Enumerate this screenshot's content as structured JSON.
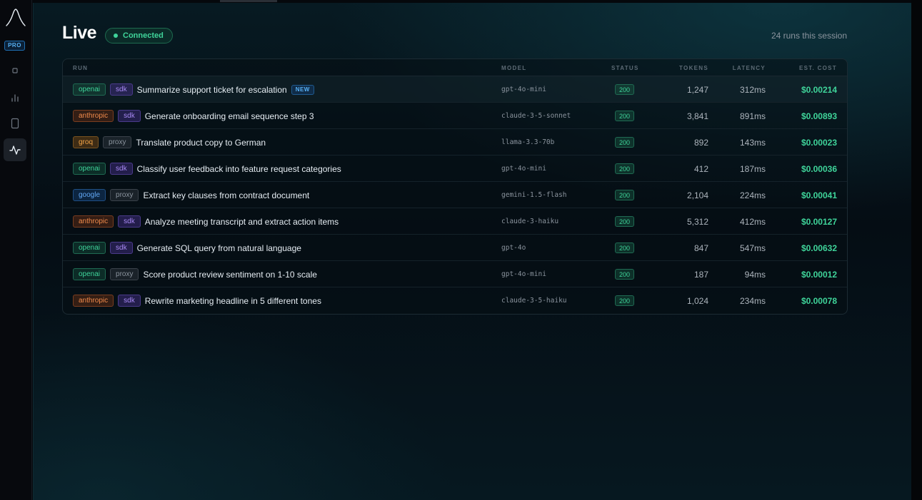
{
  "sidebar": {
    "badge": "PRO",
    "logo_icon": "sparkline-logo-icon",
    "items": [
      {
        "name": "overview",
        "icon": "square-icon",
        "active": false
      },
      {
        "name": "analytics",
        "icon": "bar-chart-icon",
        "active": false
      },
      {
        "name": "devices",
        "icon": "device-icon",
        "active": false
      },
      {
        "name": "live",
        "icon": "activity-icon",
        "active": true
      }
    ]
  },
  "header": {
    "title": "Live",
    "connection_status": "Connected",
    "session_count": "24 runs this session"
  },
  "table": {
    "columns": {
      "run": "RUN",
      "model": "MODEL",
      "status": "STATUS",
      "tokens": "TOKENS",
      "latency": "LATENCY",
      "cost": "EST. COST"
    },
    "rows": [
      {
        "provider": "openai",
        "source": "sdk",
        "title": "Summarize support ticket for escalation",
        "badge": "NEW",
        "model": "gpt-4o-mini",
        "status": "200",
        "tokens": "1,247",
        "latency": "312ms",
        "cost": "$0.00214"
      },
      {
        "provider": "anthropic",
        "source": "sdk",
        "title": "Generate onboarding email sequence step 3",
        "badge": "",
        "model": "claude-3-5-sonnet",
        "status": "200",
        "tokens": "3,841",
        "latency": "891ms",
        "cost": "$0.00893"
      },
      {
        "provider": "groq",
        "source": "proxy",
        "title": "Translate product copy to German",
        "badge": "",
        "model": "llama-3.3-70b",
        "status": "200",
        "tokens": "892",
        "latency": "143ms",
        "cost": "$0.00023"
      },
      {
        "provider": "openai",
        "source": "sdk",
        "title": "Classify user feedback into feature request categories",
        "badge": "",
        "model": "gpt-4o-mini",
        "status": "200",
        "tokens": "412",
        "latency": "187ms",
        "cost": "$0.00036"
      },
      {
        "provider": "google",
        "source": "proxy",
        "title": "Extract key clauses from contract document",
        "badge": "",
        "model": "gemini-1.5-flash",
        "status": "200",
        "tokens": "2,104",
        "latency": "224ms",
        "cost": "$0.00041"
      },
      {
        "provider": "anthropic",
        "source": "sdk",
        "title": "Analyze meeting transcript and extract action items",
        "badge": "",
        "model": "claude-3-haiku",
        "status": "200",
        "tokens": "5,312",
        "latency": "412ms",
        "cost": "$0.00127"
      },
      {
        "provider": "openai",
        "source": "sdk",
        "title": "Generate SQL query from natural language",
        "badge": "",
        "model": "gpt-4o",
        "status": "200",
        "tokens": "847",
        "latency": "547ms",
        "cost": "$0.00632"
      },
      {
        "provider": "openai",
        "source": "proxy",
        "title": "Score product review sentiment on 1-10 scale",
        "badge": "",
        "model": "gpt-4o-mini",
        "status": "200",
        "tokens": "187",
        "latency": "94ms",
        "cost": "$0.00012"
      },
      {
        "provider": "anthropic",
        "source": "sdk",
        "title": "Rewrite marketing headline in 5 different tones",
        "badge": "",
        "model": "claude-3-5-haiku",
        "status": "200",
        "tokens": "1,024",
        "latency": "234ms",
        "cost": "$0.00078"
      }
    ]
  },
  "colors": {
    "accent_green": "#3fd49a",
    "accent_blue": "#58b2f5",
    "background": "#05080c"
  }
}
